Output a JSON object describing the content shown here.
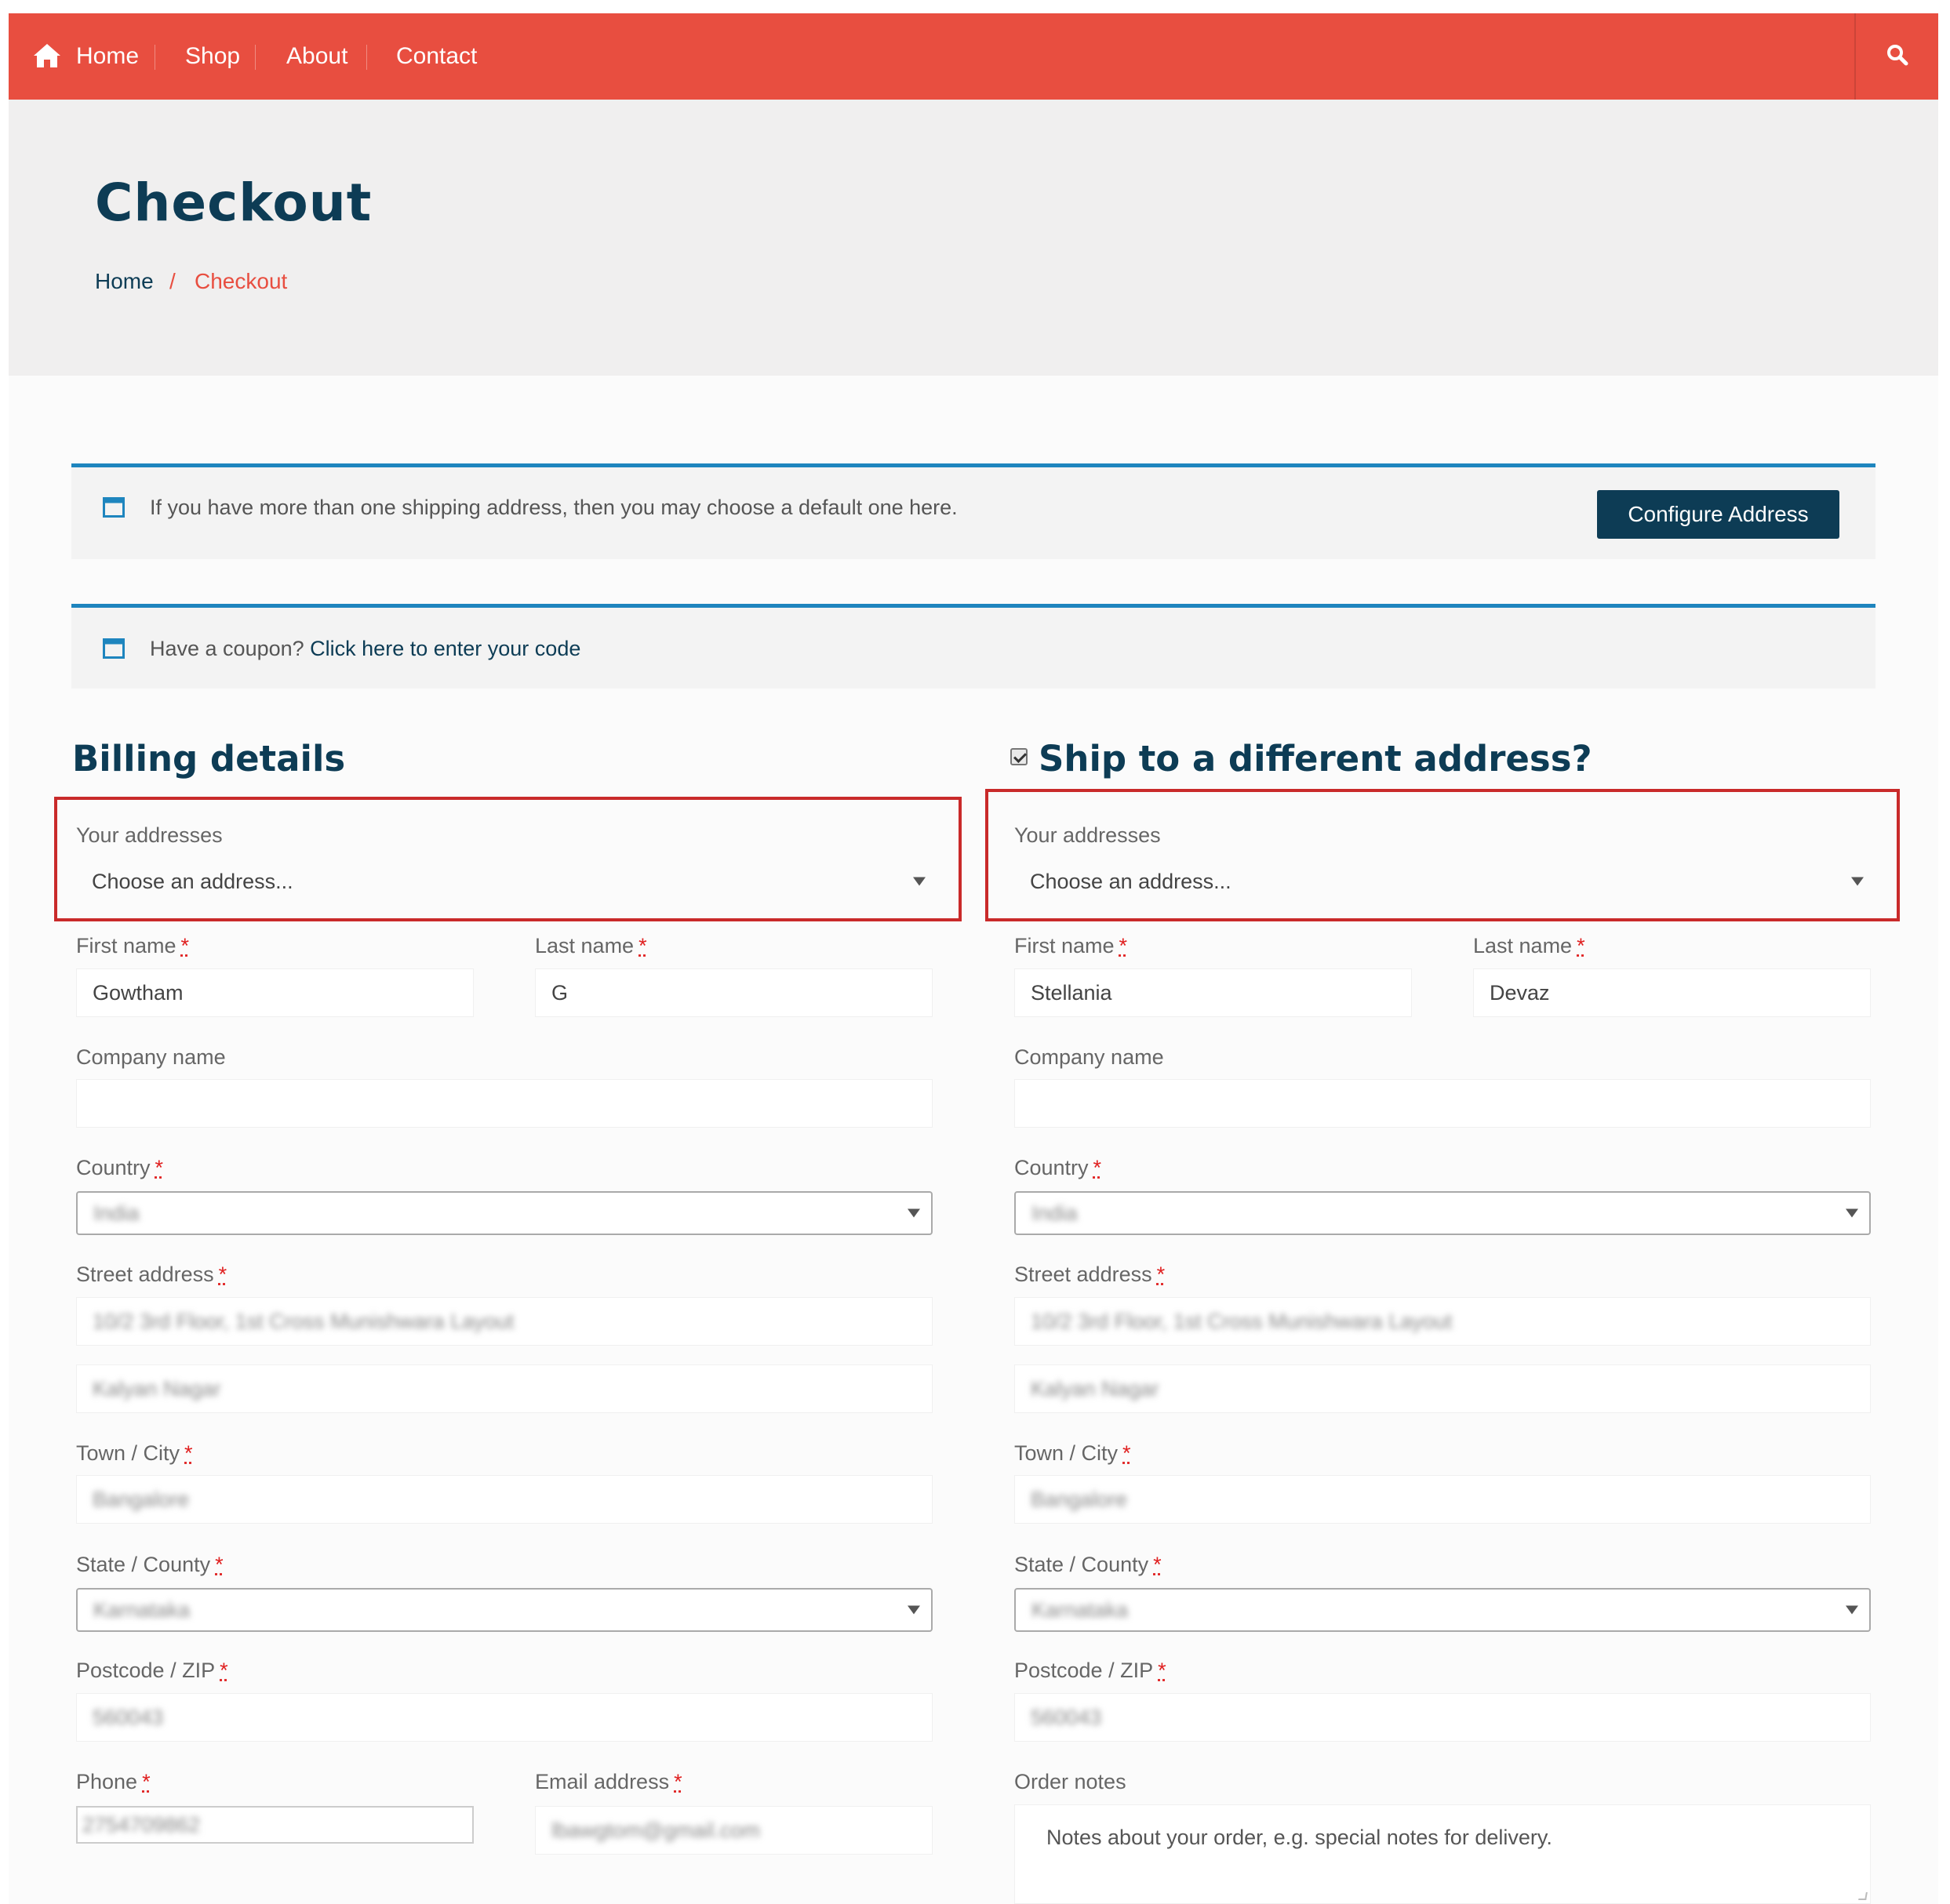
{
  "nav": {
    "items": [
      "Home",
      "Shop",
      "About",
      "Contact"
    ]
  },
  "hero": {
    "title": "Checkout",
    "breadcrumb": {
      "home": "Home",
      "separator": "/",
      "current": "Checkout"
    }
  },
  "notices": {
    "shipping": {
      "text": "If you have more than one shipping address, then you may choose a default one here.",
      "button": "Configure Address"
    },
    "coupon": {
      "text": "Have a coupon?",
      "link": "Click here to enter your code"
    }
  },
  "billing": {
    "title": "Billing details",
    "addresses_label": "Your addresses",
    "addresses_value": "Choose an address...",
    "first_name_label": "First name",
    "first_name": "Gowtham",
    "last_name_label": "Last name",
    "last_name": "G",
    "company_label": "Company name",
    "company": "",
    "country_label": "Country",
    "country": "India",
    "street_label": "Street address",
    "street_1": "10/2 3rd Floor, 1st Cross Munishwara Layout",
    "street_2": "Kalyan Nagar",
    "city_label": "Town / City",
    "city": "Bangalore",
    "state_label": "State / County",
    "state": "Karnataka",
    "postcode_label": "Postcode / ZIP",
    "postcode": "560043",
    "phone_label": "Phone",
    "phone": "2754709862",
    "email_label": "Email address",
    "email": "lbawgtom@gmail.com"
  },
  "shipping": {
    "title": "Ship to a different address?",
    "checked": true,
    "addresses_label": "Your addresses",
    "addresses_value": "Choose an address...",
    "first_name_label": "First name",
    "first_name": "Stellania",
    "last_name_label": "Last name",
    "last_name": "Devaz",
    "company_label": "Company name",
    "company": "",
    "country_label": "Country",
    "country": "India",
    "street_label": "Street address",
    "street_1": "10/2 3rd Floor, 1st Cross Munishwara Layout",
    "street_2": "Kalyan Nagar",
    "city_label": "Town / City",
    "city": "Bangalore",
    "state_label": "State / County",
    "state": "Karnataka",
    "postcode_label": "Postcode / ZIP",
    "postcode": "560043",
    "notes_label": "Order notes",
    "notes_placeholder": "Notes about your order, e.g. special notes for delivery."
  },
  "required_mark": "*",
  "colors": {
    "nav": "#e84e40",
    "primary": "#0d3c55",
    "notice_border": "#1e85be",
    "highlight": "#c92a2a"
  }
}
